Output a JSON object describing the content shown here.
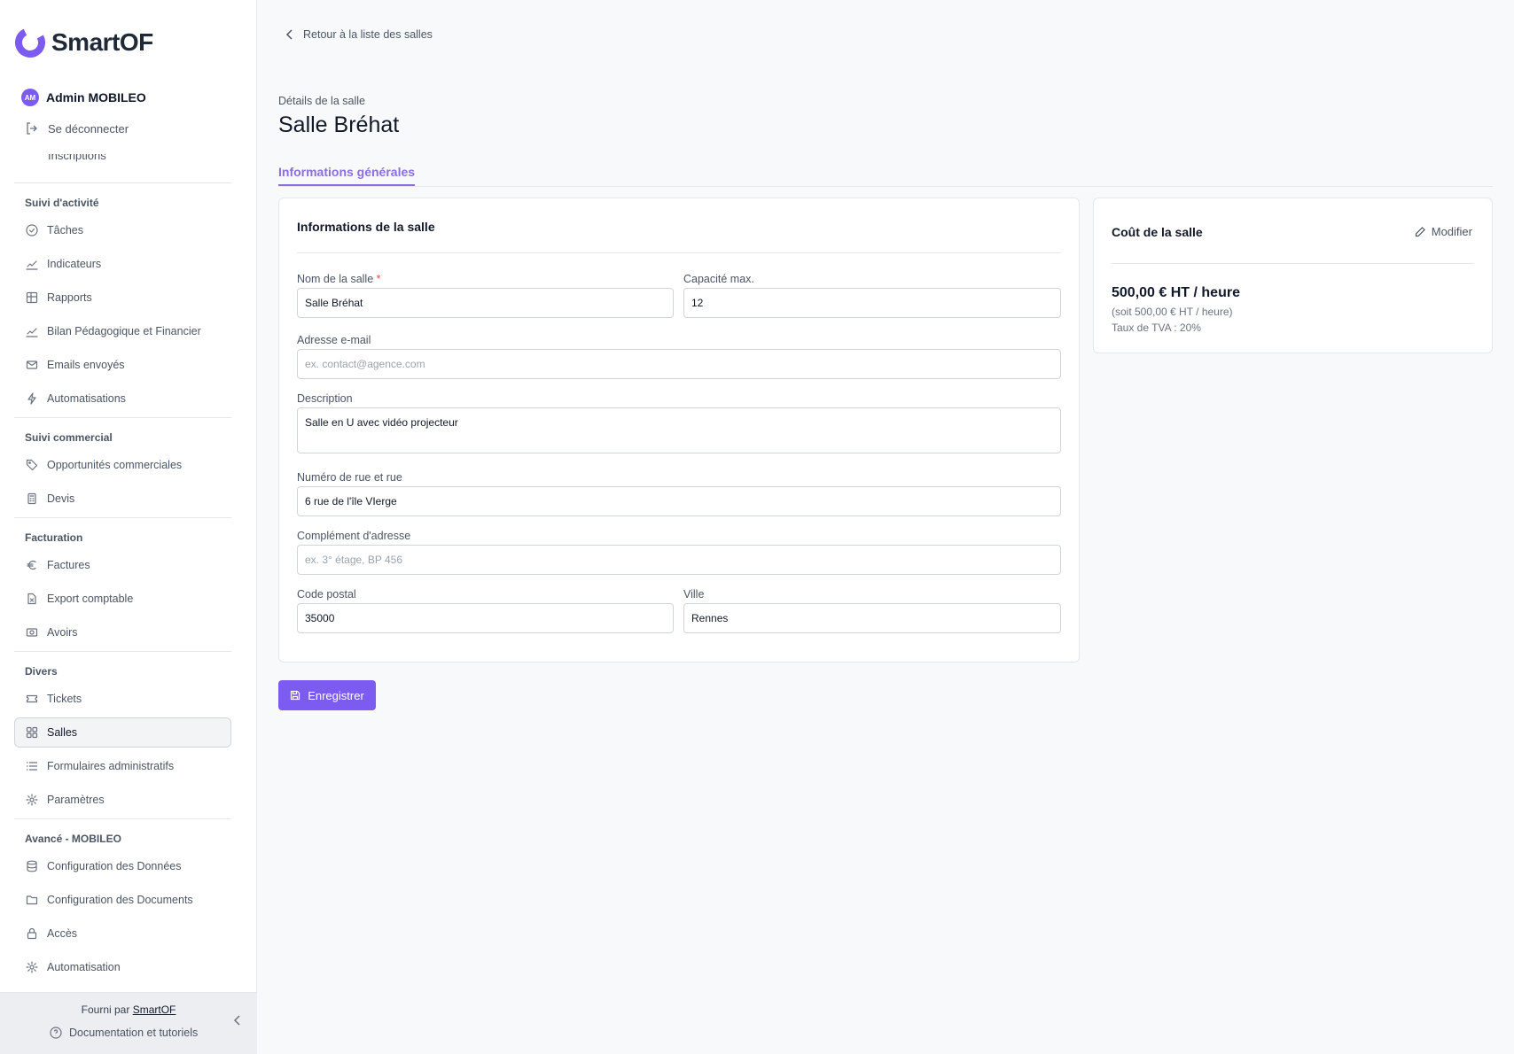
{
  "app": {
    "name": "SmartOF",
    "accent": "#7c5cf0"
  },
  "user": {
    "initials": "AM",
    "name": "Admin MOBILEO"
  },
  "logout_label": "Se déconnecter",
  "cut_item_label": "Inscriptions",
  "nav_sections": [
    {
      "title": "Suivi d'activité",
      "items": [
        {
          "label": "Tâches",
          "icon": "check-circle-icon"
        },
        {
          "label": "Indicateurs",
          "icon": "chart-line-icon"
        },
        {
          "label": "Rapports",
          "icon": "table-icon"
        },
        {
          "label": "Bilan Pédagogique et Financier",
          "icon": "chart-line-icon"
        },
        {
          "label": "Emails envoyés",
          "icon": "mail-icon"
        },
        {
          "label": "Automatisations",
          "icon": "bolt-icon"
        }
      ]
    },
    {
      "title": "Suivi commercial",
      "items": [
        {
          "label": "Opportunités commerciales",
          "icon": "tag-icon"
        },
        {
          "label": "Devis",
          "icon": "calculator-icon"
        }
      ]
    },
    {
      "title": "Facturation",
      "items": [
        {
          "label": "Factures",
          "icon": "euro-icon"
        },
        {
          "label": "Export comptable",
          "icon": "file-export-icon"
        },
        {
          "label": "Avoirs",
          "icon": "cash-icon"
        }
      ]
    },
    {
      "title": "Divers",
      "items": [
        {
          "label": "Tickets",
          "icon": "ticket-icon"
        },
        {
          "label": "Salles",
          "icon": "grid-icon",
          "active": true
        },
        {
          "label": "Formulaires administratifs",
          "icon": "list-icon"
        },
        {
          "label": "Paramètres",
          "icon": "gear-icon"
        }
      ]
    },
    {
      "title": "Avancé - MOBILEO",
      "items": [
        {
          "label": "Configuration des Données",
          "icon": "database-icon"
        },
        {
          "label": "Configuration des Documents",
          "icon": "folder-icon"
        },
        {
          "label": "Accès",
          "icon": "lock-icon"
        },
        {
          "label": "Automatisation",
          "icon": "gear-icon"
        }
      ]
    }
  ],
  "footer": {
    "powered_by": "Fourni par",
    "powered_link": "SmartOF",
    "docs_label": "Documentation et tutoriels"
  },
  "main": {
    "back_label": "Retour à la liste des salles",
    "subtitle": "Détails de la salle",
    "title": "Salle Bréhat",
    "tab_label": "Informations générales",
    "form": {
      "card_title": "Informations de la salle",
      "name_label": "Nom de la salle",
      "name_required": "*",
      "name_value": "Salle Bréhat",
      "capacity_label": "Capacité max.",
      "capacity_value": "12",
      "email_label": "Adresse e-mail",
      "email_placeholder": "ex. contact@agence.com",
      "description_label": "Description",
      "description_value": "Salle en U avec vidéo projecteur",
      "street_label": "Numéro de rue et rue",
      "street_value": "6 rue de l'île VIerge",
      "complement_label": "Complément d'adresse",
      "complement_placeholder": "ex. 3° étage, BP 456",
      "postal_label": "Code postal",
      "postal_value": "35000",
      "city_label": "Ville",
      "city_value": "Rennes"
    },
    "save_label": "Enregistrer",
    "cost": {
      "title": "Coût de la salle",
      "edit_label": "Modifier",
      "price": "500,00 € HT / heure",
      "price_sub": "(soit 500,00 € HT / heure)",
      "vat": "Taux de TVA : 20%"
    }
  }
}
